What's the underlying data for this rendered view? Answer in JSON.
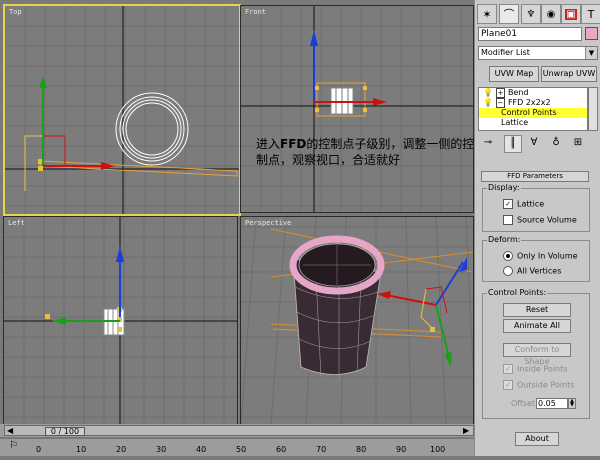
{
  "viewports": {
    "top": {
      "label": "Top"
    },
    "front": {
      "label": "Front"
    },
    "left": {
      "label": "Left"
    },
    "perspective": {
      "label": "Perspective"
    }
  },
  "caption": {
    "bold": "FFD",
    "before": "进入",
    "after": "的控制点子级别，调整一侧的控制点，观察视口，合适就好"
  },
  "timeline": {
    "frame_display": "0 / 100",
    "ticks": [
      "0",
      "10",
      "20",
      "30",
      "40",
      "50",
      "60",
      "70",
      "80",
      "90",
      "100"
    ]
  },
  "panel": {
    "object_name": "Plane01",
    "object_color": "#e8a8c8",
    "modifier_list": "Modifier List",
    "buttons": {
      "uvw_map": "UVW Map",
      "unwrap_uvw": "Unwrap UVW"
    },
    "stack": [
      {
        "label": "Bend",
        "icon": "bulb-icon"
      },
      {
        "label": "FFD 2x2x2",
        "icon": "bulb-icon"
      },
      {
        "label": "Control Points",
        "selected": true
      },
      {
        "label": "Lattice"
      }
    ],
    "rollout_title": "FFD Parameters",
    "display": {
      "title": "Display:",
      "lattice": {
        "label": "Lattice",
        "checked": true
      },
      "source_volume": {
        "label": "Source Volume",
        "checked": false
      }
    },
    "deform": {
      "title": "Deform:",
      "only_in_volume": {
        "label": "Only In Volume",
        "selected": true
      },
      "all_vertices": {
        "label": "All Vertices",
        "selected": false
      }
    },
    "control_points": {
      "title": "Control Points:",
      "reset": "Reset",
      "animate_all": "Animate All",
      "conform": "Conform to Shape",
      "inside_points": {
        "label": "Inside Points",
        "checked": true
      },
      "outside_points": {
        "label": "Outside Points",
        "checked": true
      },
      "offset_label": "Offset:",
      "offset_value": "0.05"
    },
    "about": "About"
  },
  "colors": {
    "viewport_bg": "#7c7c7c",
    "active_border": "#e8d44a",
    "lattice": "#e8a040",
    "selection_yellow": "#ffff33"
  }
}
